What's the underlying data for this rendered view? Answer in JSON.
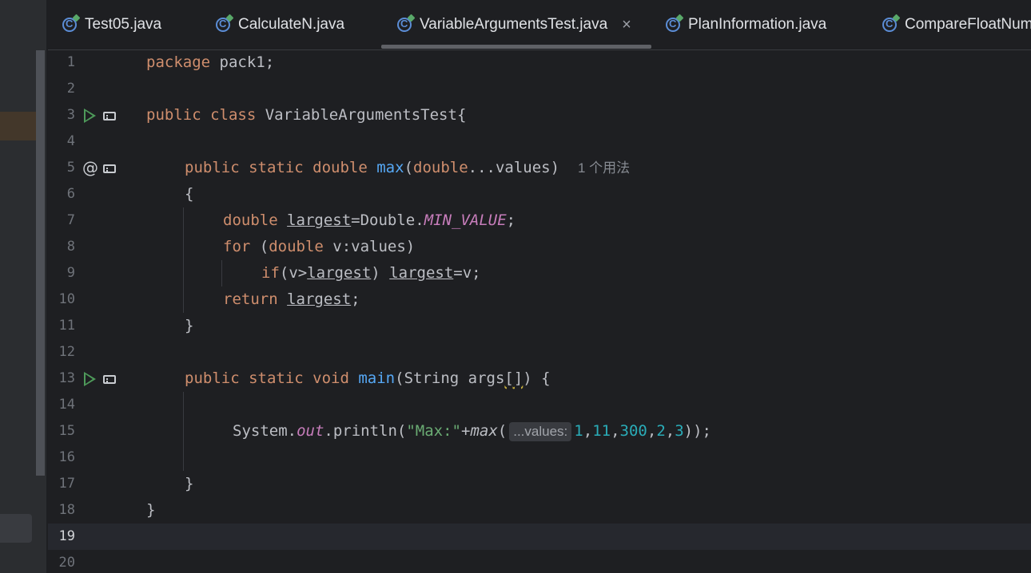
{
  "tabs": [
    {
      "label": "Test05.java"
    },
    {
      "label": "CalculateN.java"
    },
    {
      "label": "VariableArgumentsTest.java",
      "close": "×"
    },
    {
      "label": "PlanInformation.java"
    },
    {
      "label": "CompareFloatNum"
    }
  ],
  "line_numbers": [
    "1",
    "2",
    "3",
    "4",
    "5",
    "6",
    "7",
    "8",
    "9",
    "10",
    "11",
    "12",
    "13",
    "14",
    "15",
    "16",
    "17",
    "18",
    "19",
    "20"
  ],
  "code": {
    "l1_kw": "package",
    "l1_rest": " pack1;",
    "l3_kw": "public class",
    "l3_rest": " VariableArgumentsTest{",
    "l5_kw": "public static double",
    "l5_fn": "max",
    "l5_p1": "(",
    "l5_kw2": "double",
    "l5_rest": "...values)",
    "l5_hint": "1 个用法",
    "l6": "{",
    "l7_kw": "double",
    "l7_var": "largest",
    "l7_mid": "=Double.",
    "l7_const": "MIN_VALUE",
    "l7_end": ";",
    "l8_kw": "for",
    "l8_p": " (",
    "l8_kw2": "double",
    "l8_rest": " v:values)",
    "l9_kw": "if",
    "l9_a": "(v>",
    "l9_var": "largest",
    "l9_b": ") ",
    "l9_var2": "largest",
    "l9_c": "=v;",
    "l10_kw": "return",
    "l10_var": "largest",
    "l10_end": ";",
    "l11": "}",
    "l13_kw": "public static void",
    "l13_fn": "main",
    "l13_a": "(String args",
    "l13_br": "[]",
    "l13_b": ") {",
    "l15_a": "System.",
    "l15_out": "out",
    "l15_b": ".println(",
    "l15_str": "\"Max:\"",
    "l15_c": "+",
    "l15_max": "max",
    "l15_d": "(",
    "l15_inlay": "...values:",
    "l15_n1": "1",
    "l15_n2": "11",
    "l15_n3": "300",
    "l15_n4": "2",
    "l15_n5": "3",
    "l15_e": "));",
    "l15_comma": ",",
    "l17": "}",
    "l18": "}"
  }
}
